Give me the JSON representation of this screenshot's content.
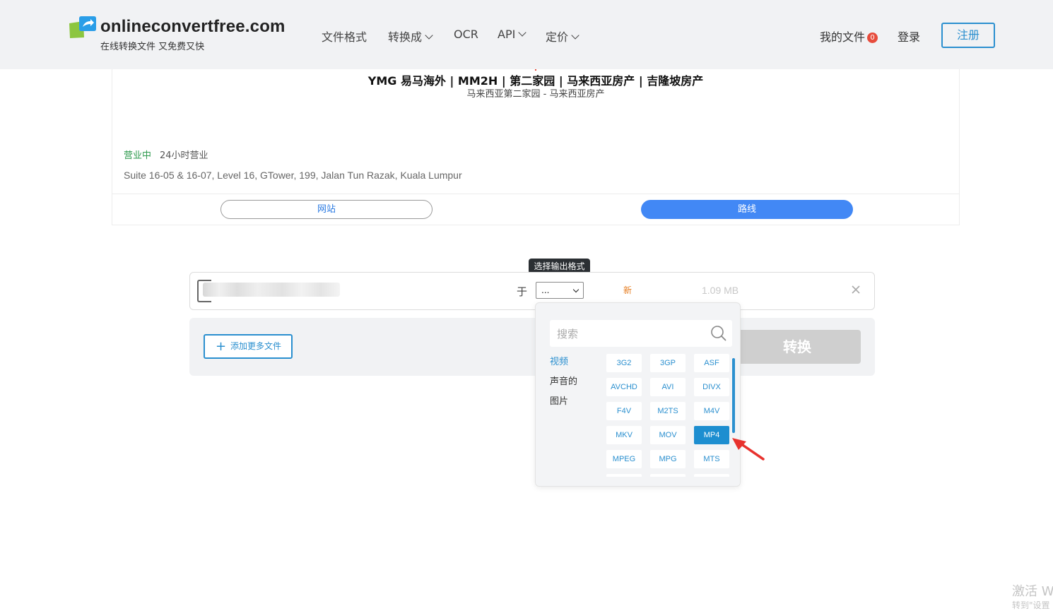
{
  "header": {
    "logo_name": "onlineconvertfree.com",
    "tagline": "在线转换文件 又免费又快",
    "nav": [
      {
        "label": "文件格式",
        "dropdown": false
      },
      {
        "label": "转换成",
        "dropdown": true
      },
      {
        "label": "OCR",
        "dropdown": false
      },
      {
        "label": "API",
        "dropdown": true
      },
      {
        "label": "定价",
        "dropdown": true
      }
    ],
    "my_files_label": "我的文件",
    "my_files_count": "0",
    "login_label": "登录",
    "register_label": "注册"
  },
  "ad": {
    "title": "YMG 易马海外 | MM2H | 第二家园 | 马来西亚房产 | 吉隆坡房产",
    "subtitle": "马来西亚第二家园 - 马来西亚房产",
    "status": "营业中",
    "hours": "24小时营业",
    "address": "Suite 16-05 & 16-07, Level 16, GTower, 199, Jalan Tun Razak, Kuala Lumpur",
    "website_label": "网站",
    "route_label": "路线"
  },
  "converter": {
    "tooltip": "选择输出格式",
    "to_label": "于",
    "selected_format": "...",
    "new_tag": "新",
    "file_size": "1.09 MB",
    "add_files_label": "添加更多文件",
    "convert_label": "转换"
  },
  "format_dropdown": {
    "search_placeholder": "搜索",
    "categories": [
      "视频",
      "声音的",
      "图片"
    ],
    "active_category": "视频",
    "formats": [
      "3G2",
      "3GP",
      "ASF",
      "AVCHD",
      "AVI",
      "DIVX",
      "F4V",
      "M2TS",
      "M4V",
      "MKV",
      "MOV",
      "MP4",
      "MPEG",
      "MPG",
      "MTS"
    ],
    "highlighted_format": "MP4"
  },
  "watermark": {
    "line1": "激活 W",
    "line2": "转到\"设置"
  },
  "colors": {
    "accent": "#2a8fcf",
    "route_button": "#4288f5",
    "badge": "#e74c3c",
    "open_status": "#2e9a4e",
    "new_tag": "#e67e22",
    "arrow": "#e8322e"
  }
}
